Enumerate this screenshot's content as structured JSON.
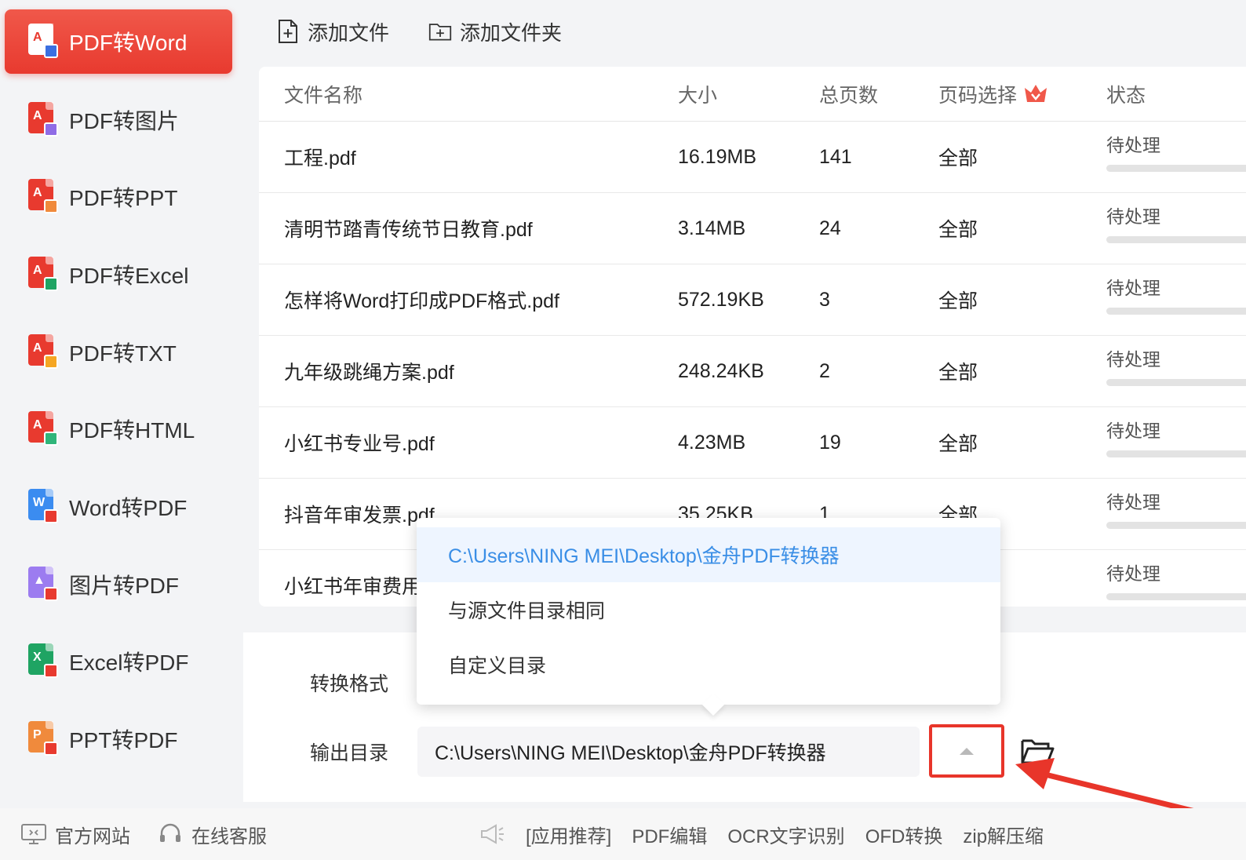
{
  "sidebar": {
    "items": [
      {
        "label": "PDF转Word",
        "active": true,
        "badge_color": "#3b6fe0"
      },
      {
        "label": "PDF转图片",
        "active": false,
        "badge_color": "#8f6ce6"
      },
      {
        "label": "PDF转PPT",
        "active": false,
        "badge_color": "#f08a3c"
      },
      {
        "label": "PDF转Excel",
        "active": false,
        "badge_color": "#1fa463"
      },
      {
        "label": "PDF转TXT",
        "active": false,
        "badge_color": "#f5a623"
      },
      {
        "label": "PDF转HTML",
        "active": false,
        "badge_color": "#2fb57a"
      },
      {
        "label": "Word转PDF",
        "active": false,
        "badge_color": "#e83a2f"
      },
      {
        "label": "图片转PDF",
        "active": false,
        "badge_color": "#e83a2f"
      },
      {
        "label": "Excel转PDF",
        "active": false,
        "badge_color": "#e83a2f"
      },
      {
        "label": "PPT转PDF",
        "active": false,
        "badge_color": "#e83a2f"
      }
    ]
  },
  "toolbar": {
    "add_file": "添加文件",
    "add_folder": "添加文件夹"
  },
  "table": {
    "headers": {
      "name": "文件名称",
      "size": "大小",
      "pages": "总页数",
      "range": "页码选择",
      "status": "状态"
    },
    "rows": [
      {
        "name": "工程.pdf",
        "size": "16.19MB",
        "pages": "141",
        "range": "全部",
        "status": "待处理",
        "progress": 0
      },
      {
        "name": "清明节踏青传统节日教育.pdf",
        "size": "3.14MB",
        "pages": "24",
        "range": "全部",
        "status": "待处理",
        "progress": 0
      },
      {
        "name": "怎样将Word打印成PDF格式.pdf",
        "size": "572.19KB",
        "pages": "3",
        "range": "全部",
        "status": "待处理",
        "progress": 0
      },
      {
        "name": "九年级跳绳方案.pdf",
        "size": "248.24KB",
        "pages": "2",
        "range": "全部",
        "status": "待处理",
        "progress": 0
      },
      {
        "name": "小红书专业号.pdf",
        "size": "4.23MB",
        "pages": "19",
        "range": "全部",
        "status": "待处理",
        "progress": 0
      },
      {
        "name": "抖音年审发票.pdf",
        "size": "35.25KB",
        "pages": "1",
        "range": "全部",
        "status": "待处理",
        "progress": 0
      },
      {
        "name": "小红书年审费用",
        "size": "",
        "pages": "",
        "range": "",
        "status": "待处理",
        "progress": 0
      }
    ]
  },
  "settings": {
    "format_label": "转换格式",
    "output_label": "输出目录",
    "output_path": "C:\\Users\\NING MEI\\Desktop\\金舟PDF转换器"
  },
  "dropdown": {
    "options": [
      {
        "label": "C:\\Users\\NING MEI\\Desktop\\金舟PDF转换器",
        "selected": true
      },
      {
        "label": "与源文件目录相同",
        "selected": false
      },
      {
        "label": "自定义目录",
        "selected": false
      }
    ]
  },
  "footer": {
    "website": "官方网站",
    "support": "在线客服",
    "recommend": "[应用推荐]",
    "links": [
      "PDF编辑",
      "OCR文字识别",
      "OFD转换",
      "zip解压缩"
    ]
  },
  "colors": {
    "accent": "#e83a2f",
    "selected_option_text": "#3a8ee6",
    "selected_option_bg": "#eef5ff"
  }
}
